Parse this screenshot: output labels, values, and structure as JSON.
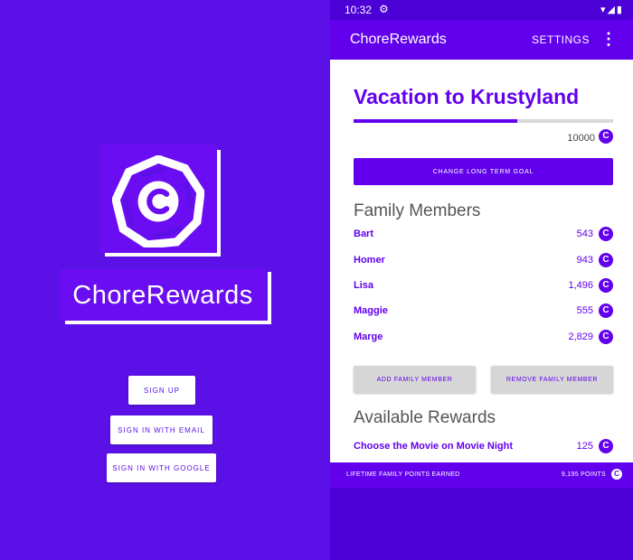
{
  "login": {
    "brand": "ChoreRewards",
    "sign_up": "SIGN UP",
    "sign_in_email": "SIGN IN WITH EMAIL",
    "sign_in_google": "SIGN IN WITH GOOGLE"
  },
  "status": {
    "time": "10:32",
    "settings_icon": "gear-icon"
  },
  "appbar": {
    "title": "ChoreRewards",
    "settings": "SETTINGS",
    "more_icon": "more-vert-icon"
  },
  "goal": {
    "title": "Vacation to Krustyland",
    "points": "10000",
    "progress_fraction": 0.63,
    "change_button": "CHANGE LONG TERM GOAL"
  },
  "family": {
    "heading": "Family Members",
    "members": [
      {
        "name": "Bart",
        "points": "543"
      },
      {
        "name": "Homer",
        "points": "943"
      },
      {
        "name": "Lisa",
        "points": "1,496"
      },
      {
        "name": "Maggie",
        "points": "555"
      },
      {
        "name": "Marge",
        "points": "2,829"
      }
    ],
    "add_button": "ADD FAMILY MEMBER",
    "remove_button": "REMOVE FAMILY MEMBER"
  },
  "rewards": {
    "heading": "Available Rewards",
    "items": [
      {
        "name": "Choose the Movie on Movie Night",
        "points": "125"
      }
    ]
  },
  "footer": {
    "label": "LIFETIME FAMILY POINTS EARNED",
    "points": "9,195 POINTS"
  },
  "colors": {
    "primary": "#6200ee",
    "background": "#5a10e6",
    "surface": "#ffffff"
  }
}
